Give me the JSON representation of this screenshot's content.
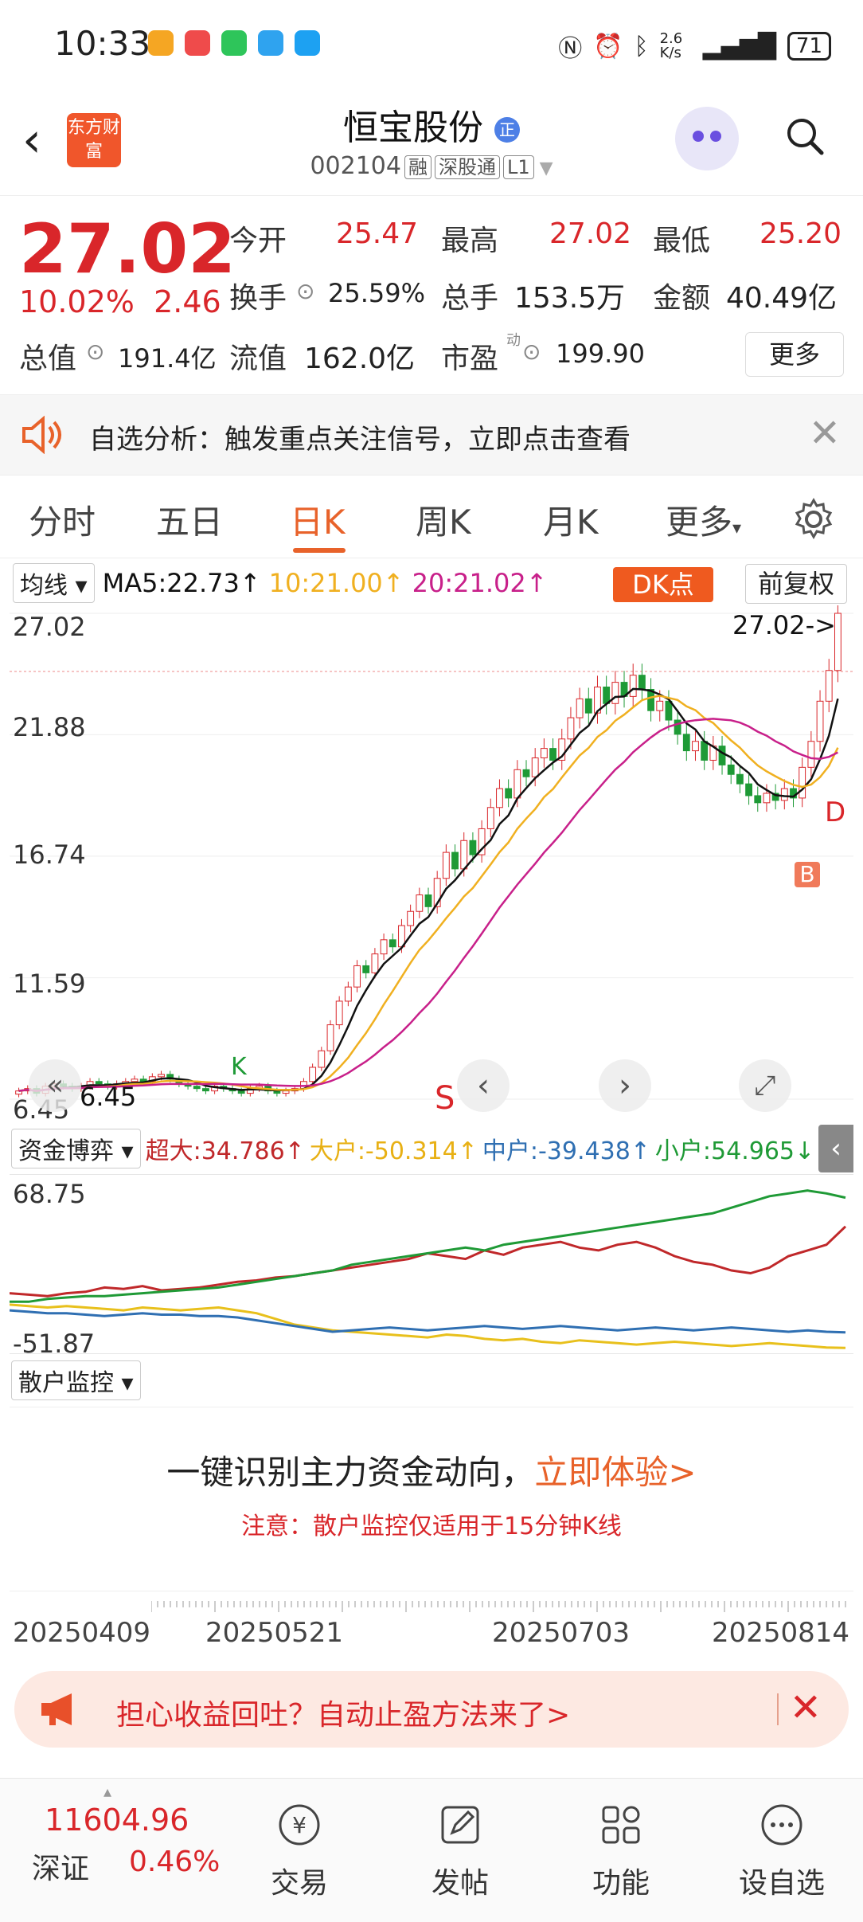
{
  "status_bar": {
    "time": "10:33",
    "net_speed": "2.6 K/s",
    "battery": "71"
  },
  "header": {
    "logo_text": "东方财富",
    "stock_name": "恒宝股份",
    "stock_badge": "正",
    "stock_code": "002104",
    "tags": [
      "融",
      "深股通",
      "L1"
    ]
  },
  "quote": {
    "price": "27.02",
    "change_pct": "10.02%",
    "change_amt": "2.46",
    "fields": [
      {
        "label": "今开",
        "value": "25.47",
        "color": "red"
      },
      {
        "label": "最高",
        "value": "27.02",
        "color": "red"
      },
      {
        "label": "最低",
        "value": "25.20",
        "color": "red"
      },
      {
        "label": "换手",
        "value": "25.59%",
        "color": "dark"
      },
      {
        "label": "总手",
        "value": "153.5万",
        "color": "dark"
      },
      {
        "label": "金额",
        "value": "40.49亿",
        "color": "dark"
      },
      {
        "label": "总值",
        "value": "191.4亿",
        "color": "dark"
      },
      {
        "label": "流值",
        "value": "162.0亿",
        "color": "dark"
      },
      {
        "label": "市盈",
        "value": "199.90",
        "color": "dark"
      }
    ],
    "pe_superscript": "动",
    "more_label": "更多"
  },
  "alert": {
    "text": "自选分析：触发重点关注信号，立即点击查看"
  },
  "tabs": [
    "分时",
    "五日",
    "日K",
    "周K",
    "月K",
    "更多"
  ],
  "active_tab": "日K",
  "kline": {
    "ma_select": "均线",
    "ma5": "MA5:22.73↑",
    "ma10": "10:21.00↑",
    "ma20": "20:21.02↑",
    "dk_label": "DK点",
    "fuquan_label": "前复权",
    "y_labels": [
      "27.02",
      "21.88",
      "16.74",
      "11.59",
      "6.45"
    ],
    "current_price_tag": "27.02->",
    "low_tag": "6.45",
    "markers": {
      "S": "S",
      "B": "B",
      "D": "D",
      "K": "K"
    },
    "colors": {
      "up": "#d9262a",
      "down": "#1e9a36",
      "ma5": "#111111",
      "ma10": "#f0b020",
      "ma20": "#c8208a"
    }
  },
  "chart_data": {
    "type": "candlestick",
    "ylim": [
      6.45,
      27.02
    ],
    "y_ticks": [
      27.02,
      21.88,
      16.74,
      11.59,
      6.45
    ],
    "x_ticks": [
      "20250409",
      "20250521",
      "20250703",
      "20250814"
    ],
    "close": [
      6.8,
      6.9,
      6.7,
      7.0,
      7.1,
      7.0,
      6.9,
      7.0,
      7.2,
      7.1,
      7.0,
      7.1,
      7.2,
      7.3,
      7.2,
      7.4,
      7.5,
      7.3,
      7.1,
      7.0,
      6.9,
      6.8,
      7.0,
      6.9,
      6.8,
      6.7,
      6.9,
      7.0,
      6.8,
      6.7,
      6.8,
      6.9,
      7.2,
      7.8,
      8.5,
      9.6,
      10.6,
      11.2,
      12.1,
      11.8,
      12.6,
      13.2,
      12.9,
      13.8,
      14.4,
      15.1,
      14.6,
      15.8,
      16.9,
      16.2,
      17.4,
      16.8,
      17.9,
      18.8,
      19.6,
      19.2,
      20.4,
      20.1,
      20.9,
      21.3,
      20.8,
      21.7,
      22.6,
      23.4,
      22.8,
      23.9,
      23.2,
      24.1,
      23.5,
      24.4,
      23.8,
      22.9,
      23.3,
      22.5,
      21.9,
      21.2,
      21.6,
      20.8,
      21.4,
      20.6,
      20.2,
      19.8,
      19.3,
      19.0,
      19.4,
      19.1,
      19.6,
      19.2,
      20.5,
      21.6,
      23.3,
      24.6,
      27.02
    ],
    "ma5_last": 22.73,
    "ma10_last": 21.0,
    "ma20_last": 21.02
  },
  "fund": {
    "select_label": "资金博弈",
    "super_large": "超大:34.786↑",
    "large": "大户:-50.314↑",
    "medium": "中户:-39.438↑",
    "small": "小户:54.965↓",
    "y_top": "68.75",
    "y_bottom": "-51.87",
    "colors": {
      "super": "#c0282a",
      "large": "#e8c01c",
      "medium": "#2f6fb2",
      "small": "#1f9a36"
    }
  },
  "fund_data": {
    "super": [
      -12,
      -13,
      -14,
      -12,
      -11,
      -8,
      -9,
      -7,
      -10,
      -9,
      -8,
      -6,
      -4,
      -3,
      -1,
      0,
      2,
      4,
      6,
      8,
      10,
      12,
      16,
      14,
      12,
      18,
      15,
      20,
      22,
      24,
      20,
      18,
      22,
      24,
      20,
      14,
      10,
      8,
      4,
      2,
      6,
      14,
      18,
      22,
      34.8
    ],
    "large": [
      -20,
      -21,
      -22,
      -21,
      -22,
      -23,
      -24,
      -22,
      -23,
      -24,
      -23,
      -22,
      -24,
      -26,
      -30,
      -34,
      -36,
      -38,
      -39,
      -40,
      -41,
      -42,
      -43,
      -41,
      -42,
      -44,
      -45,
      -44,
      -46,
      -47,
      -45,
      -46,
      -47,
      -48,
      -47,
      -46,
      -47,
      -48,
      -49,
      -48,
      -47,
      -48,
      -49,
      -50,
      -50.3
    ],
    "medium": [
      -24,
      -25,
      -26,
      -26,
      -27,
      -28,
      -27,
      -26,
      -27,
      -27,
      -28,
      -28,
      -29,
      -31,
      -33,
      -35,
      -37,
      -39,
      -38,
      -37,
      -36,
      -37,
      -38,
      -37,
      -36,
      -35,
      -36,
      -37,
      -36,
      -35,
      -36,
      -37,
      -38,
      -37,
      -36,
      -37,
      -38,
      -37,
      -36,
      -37,
      -38,
      -39,
      -38,
      -39,
      -39.4
    ],
    "small": [
      -18,
      -18,
      -16,
      -15,
      -14,
      -14,
      -13,
      -12,
      -11,
      -10,
      -9,
      -8,
      -6,
      -4,
      -2,
      0,
      2,
      4,
      8,
      10,
      12,
      14,
      16,
      18,
      20,
      18,
      22,
      24,
      26,
      28,
      30,
      32,
      34,
      36,
      38,
      40,
      42,
      44,
      48,
      52,
      56,
      58,
      60,
      58,
      55.0
    ]
  },
  "sanhu": {
    "select_label": "散户监控",
    "promo_main": "一键识别主力资金动向，",
    "promo_link": "立即体验>",
    "promo_note": "注意：散户监控仅适用于15分钟K线"
  },
  "dates": [
    "20250409",
    "20250521",
    "20250703",
    "20250814"
  ],
  "banner": {
    "text": "担心收益回吐？自动止盈方法来了>"
  },
  "bottom_bar": {
    "index_value": "11604.96",
    "index_name": "深证",
    "index_pct": "0.46%",
    "items": [
      "交易",
      "发帖",
      "功能",
      "设自选"
    ]
  }
}
